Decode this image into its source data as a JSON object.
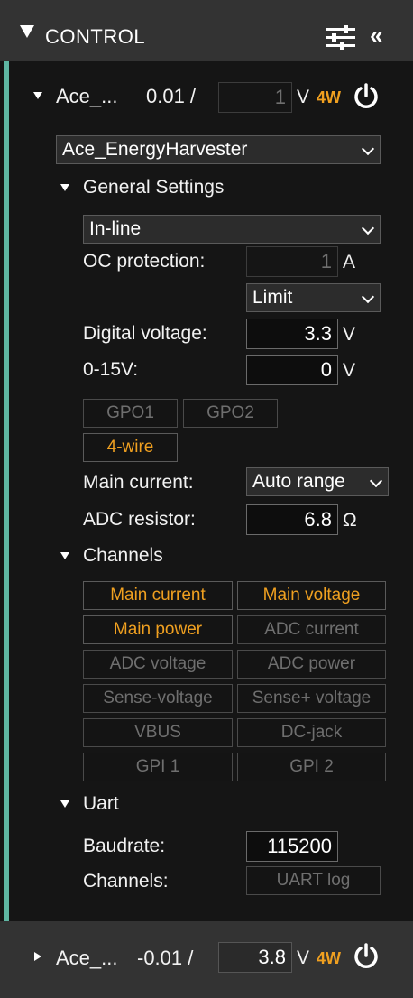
{
  "header": {
    "title": "CONTROL",
    "settings_icon": "sliders-icon",
    "collapse_label": "«"
  },
  "device1": {
    "short_name": "Ace_...",
    "reading": "0.01 /",
    "voltage_setpoint": "1",
    "unit": "V",
    "mode_badge": "4W",
    "power_icon": "power-icon",
    "device_select": "Ace_EnergyHarvester",
    "general": {
      "title": "General Settings",
      "mode_select": "In-line",
      "oc_label": "OC protection:",
      "oc_value": "1",
      "oc_unit": "A",
      "oc_mode": "Limit",
      "digital_label": "Digital voltage:",
      "digital_value": "3.3",
      "digital_unit": "V",
      "range_label": "0-15V:",
      "range_value": "0",
      "range_unit": "V",
      "gpo1": "GPO1",
      "gpo2": "GPO2",
      "four_wire": "4-wire",
      "main_current_label": "Main current:",
      "main_current_value": "Auto range",
      "adc_label": "ADC resistor:",
      "adc_value": "6.8",
      "adc_unit": "Ω"
    },
    "channels": {
      "title": "Channels",
      "items": [
        {
          "label": "Main current",
          "active": true
        },
        {
          "label": "Main voltage",
          "active": true
        },
        {
          "label": "Main power",
          "active": true
        },
        {
          "label": "ADC current",
          "active": false
        },
        {
          "label": "ADC voltage",
          "active": false
        },
        {
          "label": "ADC power",
          "active": false
        },
        {
          "label": "Sense-voltage",
          "active": false
        },
        {
          "label": "Sense+ voltage",
          "active": false
        },
        {
          "label": "VBUS",
          "active": false
        },
        {
          "label": "DC-jack",
          "active": false
        },
        {
          "label": "GPI 1",
          "active": false
        },
        {
          "label": "GPI 2",
          "active": false
        }
      ]
    },
    "uart": {
      "title": "Uart",
      "baud_label": "Baudrate:",
      "baud_value": "115200",
      "channels_label": "Channels:",
      "log_button": "UART log"
    }
  },
  "device2": {
    "short_name": "Ace_...",
    "reading": "-0.01 /",
    "voltage_setpoint": "3.8",
    "unit": "V",
    "mode_badge": "4W",
    "power_icon": "power-icon"
  },
  "colors": {
    "accent_bar": "#5fb6a3",
    "active": "#f0a020",
    "header_bg": "#333333"
  }
}
